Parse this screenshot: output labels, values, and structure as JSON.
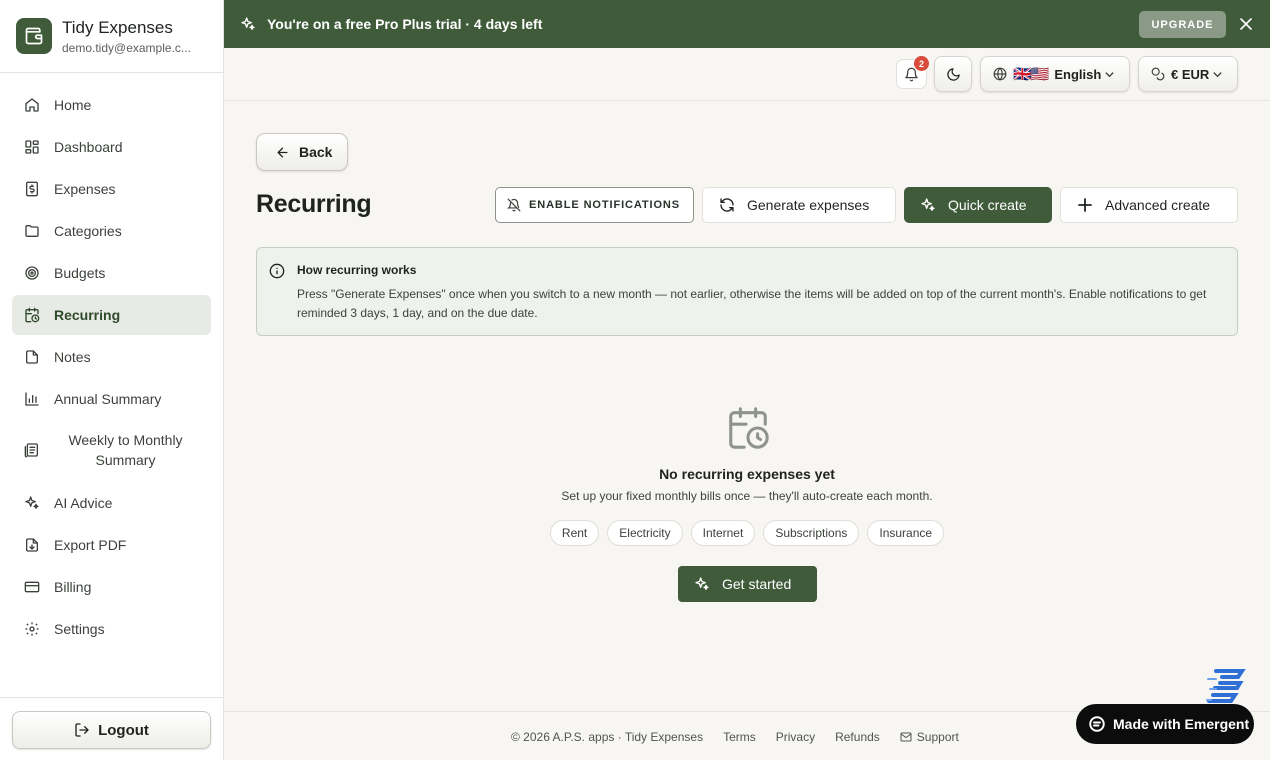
{
  "brand": {
    "name": "Tidy Expenses",
    "email": "demo.tidy@example.c..."
  },
  "sidebar": {
    "items": [
      {
        "label": "Home",
        "icon": "home-icon"
      },
      {
        "label": "Dashboard",
        "icon": "dashboard-icon"
      },
      {
        "label": "Expenses",
        "icon": "receipt-icon"
      },
      {
        "label": "Categories",
        "icon": "folder-icon"
      },
      {
        "label": "Budgets",
        "icon": "target-icon"
      },
      {
        "label": "Recurring",
        "icon": "calendar-clock-icon",
        "active": true
      },
      {
        "label": "Notes",
        "icon": "note-icon"
      },
      {
        "label": "Annual Summary",
        "icon": "bar-chart-icon"
      },
      {
        "label": "Weekly to Monthly Summary",
        "icon": "document-list-icon"
      },
      {
        "label": "AI Advice",
        "icon": "sparkles-icon"
      },
      {
        "label": "Export PDF",
        "icon": "file-download-icon"
      },
      {
        "label": "Billing",
        "icon": "credit-card-icon"
      },
      {
        "label": "Settings",
        "icon": "gear-icon"
      }
    ],
    "logout_label": "Logout"
  },
  "banner": {
    "text": "You're on a free Pro Plus trial · 4 days left",
    "upgrade_label": "UPGRADE"
  },
  "topbar": {
    "notification_count": "2",
    "language_flags": "🇬🇧🇺🇸",
    "language_label": "English",
    "currency_label": "€ EUR"
  },
  "main": {
    "back_label": "Back",
    "title": "Recurring",
    "actions": {
      "enable_notifications": "ENABLE NOTIFICATIONS",
      "generate_expenses": "Generate expenses",
      "quick_create": "Quick create",
      "advanced_create": "Advanced create"
    },
    "info": {
      "title": "How recurring works",
      "text": "Press \"Generate Expenses\" once when you switch to a new month — not earlier, otherwise the items will be added on top of the current month's. Enable notifications to get reminded 3 days, 1 day, and on the due date."
    },
    "empty": {
      "title": "No recurring expenses yet",
      "subtitle": "Set up your fixed monthly bills once — they'll auto-create each month.",
      "chips": [
        "Rent",
        "Electricity",
        "Internet",
        "Subscriptions",
        "Insurance"
      ],
      "cta_label": "Get started"
    }
  },
  "footer": {
    "copyright": "© 2026 A.P.S. apps · Tidy Expenses",
    "terms": "Terms",
    "privacy": "Privacy",
    "refunds": "Refunds",
    "support": "Support"
  },
  "badge": {
    "label": "Made with Emergent"
  },
  "colors": {
    "accent": "#3f5b3a",
    "background": "#f7f6f3",
    "badge_red": "#d84a3a"
  }
}
